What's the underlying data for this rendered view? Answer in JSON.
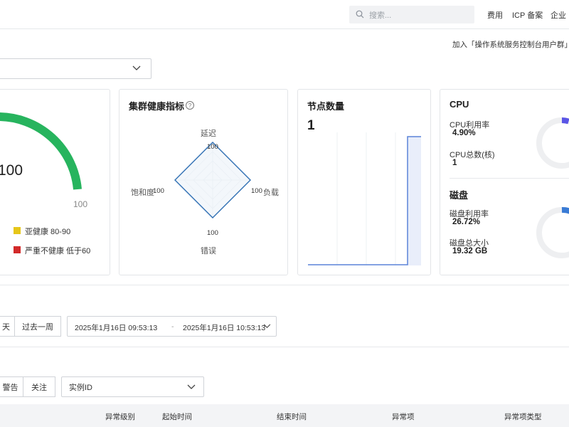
{
  "header": {
    "search_placeholder": "搜索...",
    "nav": [
      "费用",
      "ICP 备案",
      "企业"
    ]
  },
  "join_text": "加入「操作系统服务控制台用户群」",
  "health_card": {
    "score": "100",
    "max_label": "100",
    "legend": [
      {
        "label": "亚健康 80-90",
        "color": "#e6c619"
      },
      {
        "label": "严重不健康 低于60",
        "color": "#d22a2a"
      }
    ],
    "colors": {
      "arc": "#27b45e"
    }
  },
  "radar_card": {
    "title": "集群健康指标",
    "axes": [
      {
        "label": "延迟",
        "value": "100"
      },
      {
        "label": "负载",
        "value": "100"
      },
      {
        "label": "错误",
        "value": "100"
      },
      {
        "label": "饱和度",
        "value": "100"
      }
    ]
  },
  "nodes_card": {
    "title": "节点数量",
    "count": "1"
  },
  "cpu_card": {
    "cpu_title": "CPU",
    "cpu_usage_label": "CPU利用率",
    "cpu_usage_value": "4.90%",
    "cpu_total_label": "CPU总数(核)",
    "cpu_total_value": "1",
    "disk_title": "磁盘",
    "disk_usage_label": "磁盘利用率",
    "disk_usage_value": "26.72%",
    "disk_total_label": "磁盘总大小",
    "disk_total_value": "19.32 GB"
  },
  "time_filter": {
    "partial_btn": "天",
    "week_btn": "过去一周",
    "start": "2025年1月16日 09:53:13",
    "separator": "-",
    "end": "2025年1月16日 10:53:13"
  },
  "filters": {
    "warning_btn": "警告",
    "follow_btn": "关注",
    "instance_select": "实例ID"
  },
  "table": {
    "columns": [
      "异常级别",
      "起始时间",
      "结束时间",
      "异常项",
      "异常项类型"
    ]
  }
}
